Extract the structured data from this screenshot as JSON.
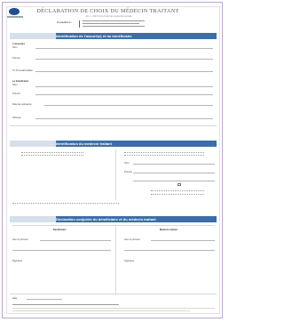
{
  "header": {
    "title": "DÉCLARATION DE CHOIX DU MÉDECIN TRAITANT",
    "subtitle": "art. L. 162-5-3 du Code de la sécurité sociale",
    "ref_label": "Formulaire à :"
  },
  "sections": {
    "insured": "Identification de l'assuré(e) et du bénéficiaire",
    "doctor": "Identification du médecin traitant",
    "signatures": "Déclaration conjointe du bénéficiaire et du médecin traitant"
  },
  "fields": {
    "assure": "L'assuré(e)",
    "beneficiaire": "Le bénéficiaire",
    "nom": "Nom",
    "prenom": "Prénom",
    "numero": "N° d'immatriculation",
    "adresse": "Adresse",
    "date_naissance": "Date de naissance",
    "nom_prenom": "Nom et prénom",
    "signature": "Signature",
    "date": "Date"
  },
  "columns": {
    "left": "Bénéficiaire",
    "right": "Médecin traitant"
  },
  "icons": {
    "logo": "assurance-maladie-logo"
  },
  "colors": {
    "band": "#3d6ea6",
    "frame": "#b9a9cf"
  }
}
